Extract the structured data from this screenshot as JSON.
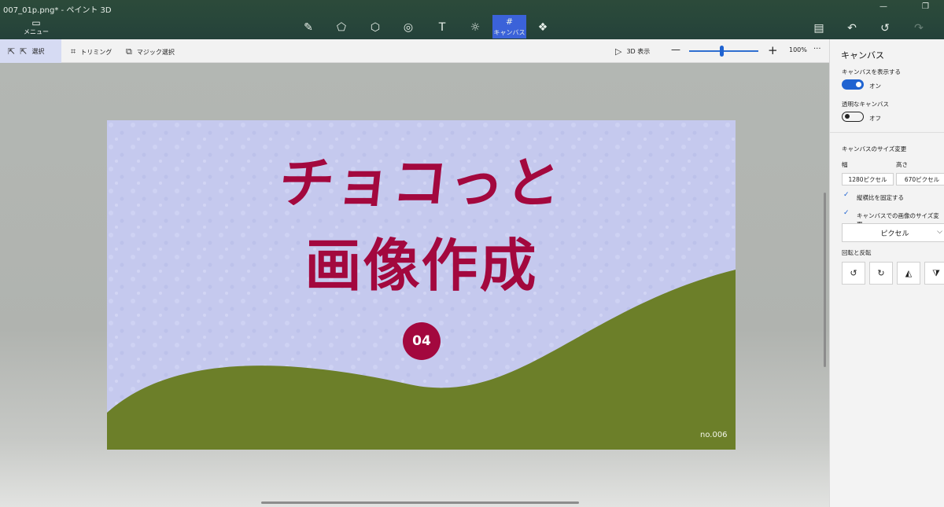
{
  "window": {
    "title": "007_01p.png* - ペイント 3D",
    "menu_label": "メニュー"
  },
  "toolbar": {
    "tools": [
      {
        "name": "brushes",
        "icon": "brush-icon",
        "glyph": "✎"
      },
      {
        "name": "2d-shapes",
        "icon": "2d-shapes-icon",
        "glyph": "⬠"
      },
      {
        "name": "3d-shapes",
        "icon": "3d-shapes-icon",
        "glyph": "⬡"
      },
      {
        "name": "stickers",
        "icon": "stickers-icon",
        "glyph": "◎"
      },
      {
        "name": "text",
        "icon": "text-icon",
        "glyph": "T"
      },
      {
        "name": "effects",
        "icon": "effects-icon",
        "glyph": "☼"
      },
      {
        "name": "canvas",
        "icon": "canvas-icon",
        "glyph": "#",
        "label": "キャンバス",
        "active": true
      },
      {
        "name": "3d-library",
        "icon": "3d-library-icon",
        "glyph": "❖"
      }
    ],
    "right_tools": [
      {
        "name": "paste",
        "icon": "paste-icon",
        "glyph": "▤"
      },
      {
        "name": "undo",
        "icon": "undo-icon",
        "glyph": "↶"
      },
      {
        "name": "history",
        "icon": "history-icon",
        "glyph": "↺"
      },
      {
        "name": "redo",
        "icon": "redo-icon",
        "glyph": "↷"
      }
    ]
  },
  "subbar": {
    "select_label": "選択",
    "crop_label": "トリミング",
    "magic_select_label": "マジック選択",
    "view3d_label": "3D 表示",
    "zoom_minus": "—",
    "zoom_plus": "+",
    "zoom_level": "100%",
    "more": "···",
    "zoom_fraction": 0.47
  },
  "canvas_image": {
    "line1": "チョコっと",
    "line2": "画像作成",
    "badge": "04",
    "serial": "no.006",
    "colors": {
      "sky": "#c5c9ee",
      "hill": "#6c7f29",
      "text": "#a3083e"
    }
  },
  "panel": {
    "title": "キャンバス",
    "show_canvas_label": "キャンバスを表示する",
    "show_canvas_state": "オン",
    "transparent_label": "透明なキャンバス",
    "transparent_state": "オフ",
    "resize_label": "キャンバスのサイズ変更",
    "width_label": "幅",
    "height_label": "高さ",
    "width_value": "1280ピクセル",
    "height_value": "670ピクセル",
    "lock_aspect_label": "縦横比を固定する",
    "resize_image_label": "キャンバスでの画像のサイズ変更",
    "unit_value": "ピクセル",
    "rotate_label": "回転と反転"
  }
}
